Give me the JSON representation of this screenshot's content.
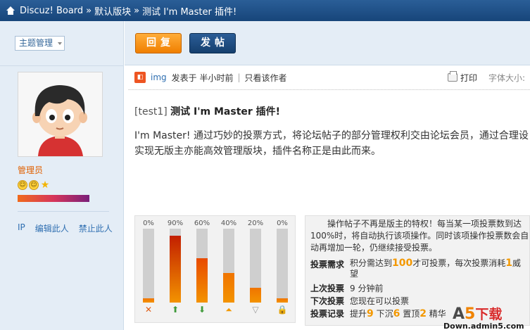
{
  "breadcrumb": {
    "items": [
      "Discuz! Board",
      "默认版块",
      "测试 I'm Master 插件!"
    ],
    "separator": "»"
  },
  "sidebar": {
    "mod_select": "主题管理",
    "role": "管理员",
    "links": [
      "IP",
      "编辑此人",
      "禁止此人"
    ]
  },
  "toolbar": {
    "reply_label": "回复",
    "post_label": "发帖"
  },
  "meta": {
    "icon": "img-icon",
    "author": "img",
    "posted": "发表于",
    "time": "半小时前",
    "only_author": "只看该作者",
    "print": "打印",
    "font_size": "字体大小:"
  },
  "post": {
    "tag": "[test1]",
    "title": "测试 I'm Master 插件!",
    "body_line1": "I'm Master! 通过巧妙的投票方式，将论坛帖子的部分管理权利交由论坛会员，通过合理设",
    "body_line2": "实现无版主亦能高效管理版块，插件名称正是由此而来。"
  },
  "poll": {
    "options": [
      {
        "percent": "0%",
        "value": 0.06,
        "icon": "close-icon",
        "color": "#f07400"
      },
      {
        "percent": "90%",
        "value": 0.9,
        "icon": "arrow-up-icon",
        "color": "#c21f00"
      },
      {
        "percent": "60%",
        "value": 0.6,
        "icon": "arrow-down-icon",
        "color": "#e84a00"
      },
      {
        "percent": "40%",
        "value": 0.4,
        "icon": "pin-top-icon",
        "color": "#f07400"
      },
      {
        "percent": "20%",
        "value": 0.2,
        "icon": "sink-icon",
        "color": "#f07400"
      },
      {
        "percent": "0%",
        "value": 0.06,
        "icon": "lock-icon",
        "color": "#f07400"
      }
    ]
  },
  "info": {
    "description": "操作帖子不再是版主的特权！每当某一项投票数到达100%时，将自动执行该项操作。同时该项操作投票数会自动再增加一轮，仍继续接受投票。",
    "requirement_label": "投票需求",
    "requirement_pre": "积分需达到",
    "requirement_points": "100",
    "requirement_mid": "才可投票，每次投票消耗",
    "requirement_cost": "1",
    "requirement_post": "威望",
    "last_vote_label": "上次投票",
    "last_vote": "9 分钟前",
    "next_vote_label": "下次投票",
    "next_vote": "您现在可以投票",
    "record_label": "投票记录",
    "record_up": "提升",
    "record_up_n": "9",
    "record_down": "下沉",
    "record_down_n": "6",
    "record_top": "置顶",
    "record_top_n": "2",
    "record_digest": "精华"
  },
  "watermark": {
    "logo_a": "A",
    "logo_5": "5",
    "logo_dl": "下载",
    "domain": "Down.admin5.com"
  }
}
